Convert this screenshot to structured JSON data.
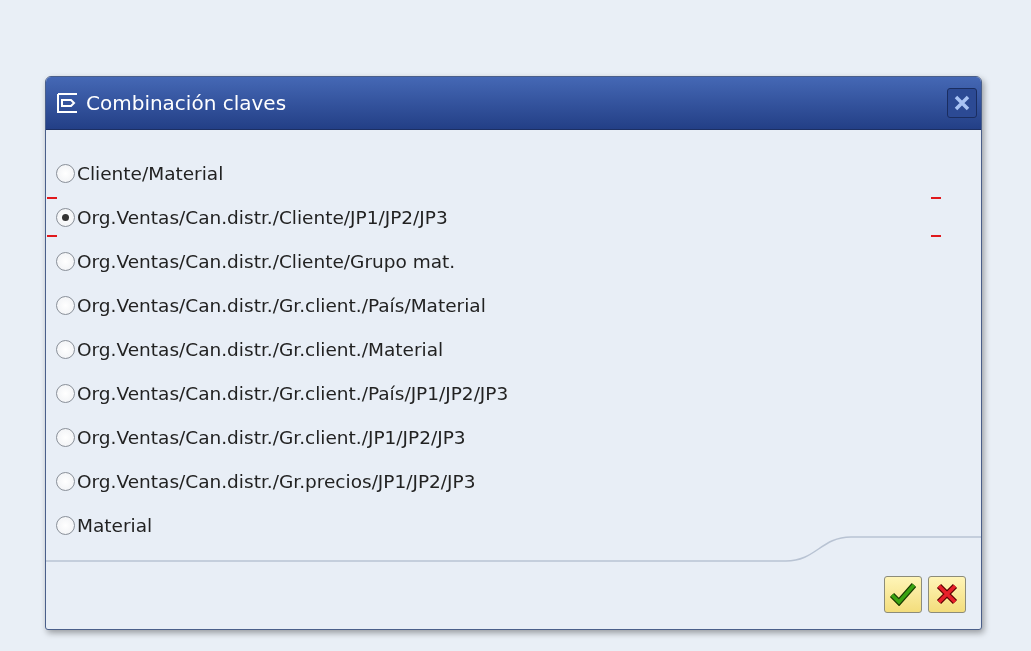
{
  "dialog": {
    "title": "Combinación claves"
  },
  "options": [
    {
      "label": "Cliente/Material",
      "selected": false
    },
    {
      "label": "Org.Ventas/Can.distr./Cliente/JP1/JP2/JP3",
      "selected": true
    },
    {
      "label": "Org.Ventas/Can.distr./Cliente/Grupo mat.",
      "selected": false
    },
    {
      "label": "Org.Ventas/Can.distr./Gr.client./País/Material",
      "selected": false
    },
    {
      "label": "Org.Ventas/Can.distr./Gr.client./Material",
      "selected": false
    },
    {
      "label": "Org.Ventas/Can.distr./Gr.client./País/JP1/JP2/JP3",
      "selected": false
    },
    {
      "label": "Org.Ventas/Can.distr./Gr.client./JP1/JP2/JP3",
      "selected": false
    },
    {
      "label": "Org.Ventas/Can.distr./Gr.precios/JP1/JP2/JP3",
      "selected": false
    },
    {
      "label": "Material",
      "selected": false
    }
  ]
}
